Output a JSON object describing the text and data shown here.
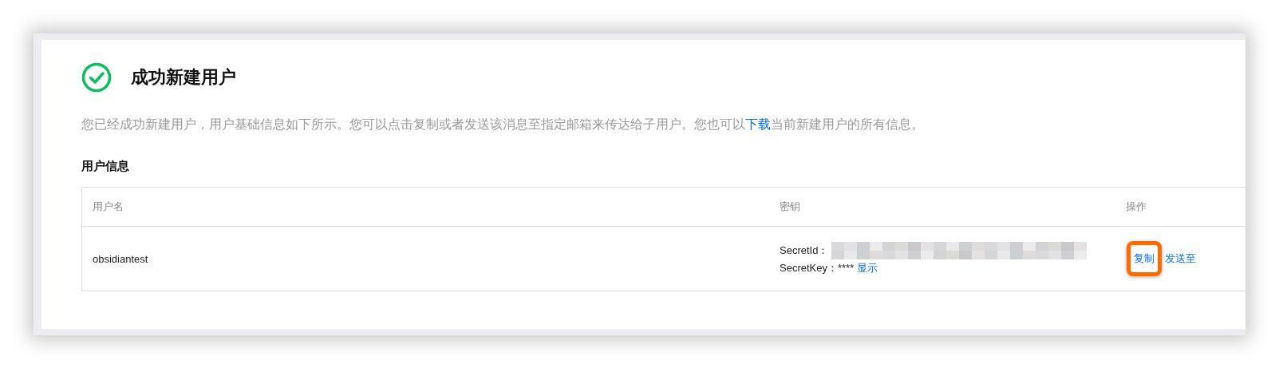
{
  "title": "成功新建用户",
  "description": {
    "before": "您已经成功新建用户，用户基础信息如下所示。您可以点击复制或者发送该消息至指定邮箱来传达给子用户。您也可以",
    "link": "下载",
    "after": "当前新建用户的所有信息。"
  },
  "section_title": "用户信息",
  "table": {
    "columns": [
      "用户名",
      "密钥",
      "操作"
    ],
    "rows": [
      {
        "username": "obsidiantest",
        "secret_id_label": "SecretId：",
        "secret_id_redacted": true,
        "secret_key_label": "SecretKey：****",
        "show_link": "显示",
        "actions": [
          {
            "label": "复制",
            "highlighted": true
          },
          {
            "label": "发送至",
            "highlighted": false
          }
        ]
      }
    ]
  }
}
